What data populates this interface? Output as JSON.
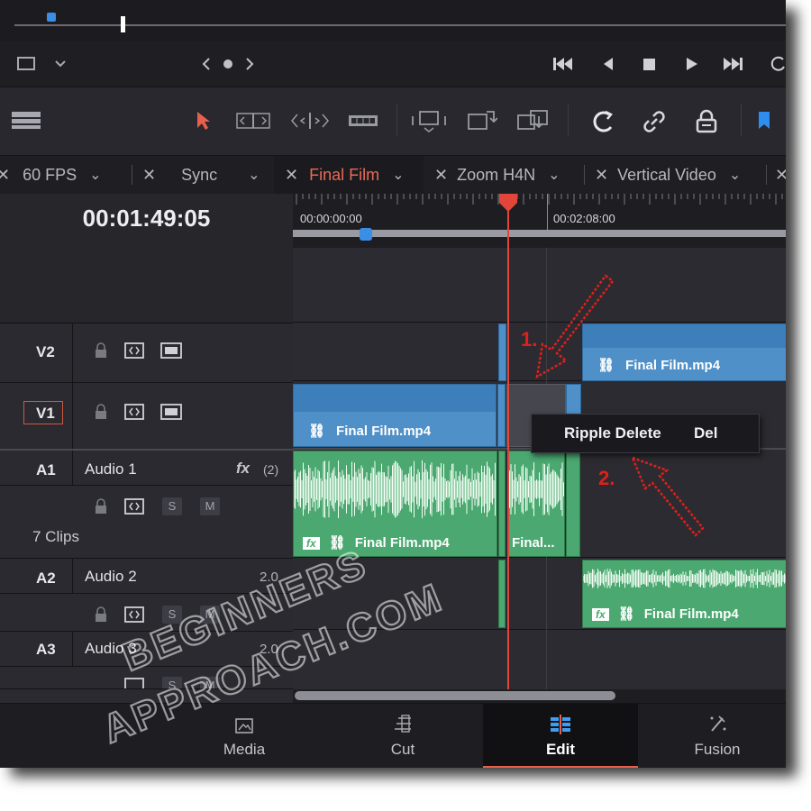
{
  "timeline": {
    "timecode": "00:01:49:05",
    "ruler_marks": [
      "00:00:00:00",
      "00:02:08:00"
    ]
  },
  "tabs": [
    {
      "label": "60 FPS",
      "active": false
    },
    {
      "label": "Sync",
      "active": false
    },
    {
      "label": "Final Film",
      "active": true
    },
    {
      "label": "Zoom H4N",
      "active": false
    },
    {
      "label": "Vertical Video",
      "active": false
    }
  ],
  "tracks": {
    "v2": {
      "id": "V2"
    },
    "v1": {
      "id": "V1"
    },
    "a1": {
      "id": "A1",
      "name": "Audio 1",
      "fx": "fx",
      "fx_count": "(2)",
      "clips": "7 Clips",
      "s": "S",
      "m": "M"
    },
    "a2": {
      "id": "A2",
      "name": "Audio 2",
      "channels": "2.0",
      "s": "S",
      "m": "M"
    },
    "a3": {
      "id": "A3",
      "name": "Audio 3",
      "channels": "2.0",
      "s": "S",
      "m": "M"
    }
  },
  "clips": {
    "v1_clip": "Final Film.mp4",
    "v2_clip": "Final Film.mp4",
    "a1_clip": "Final Film.mp4",
    "a1_clip2": "Final...",
    "a2_clip": "Final Film.mp4",
    "fx_badge": "fx"
  },
  "context_menu": {
    "item": "Ripple Delete",
    "shortcut": "Del"
  },
  "annotations": {
    "step1": "1.",
    "step2": "2."
  },
  "bottom_tabs": [
    {
      "label": "Media",
      "active": false
    },
    {
      "label": "Cut",
      "active": false
    },
    {
      "label": "Edit",
      "active": true
    },
    {
      "label": "Fusion",
      "active": false
    }
  ],
  "watermark": {
    "line1": "BEGINNERS",
    "line2": "APPROACH.COM"
  },
  "colors": {
    "accent": "#e8604c",
    "video_clip": "#4f90c8",
    "audio_clip": "#4ba870",
    "playhead": "#e2463a",
    "annotation": "#e0201a"
  }
}
